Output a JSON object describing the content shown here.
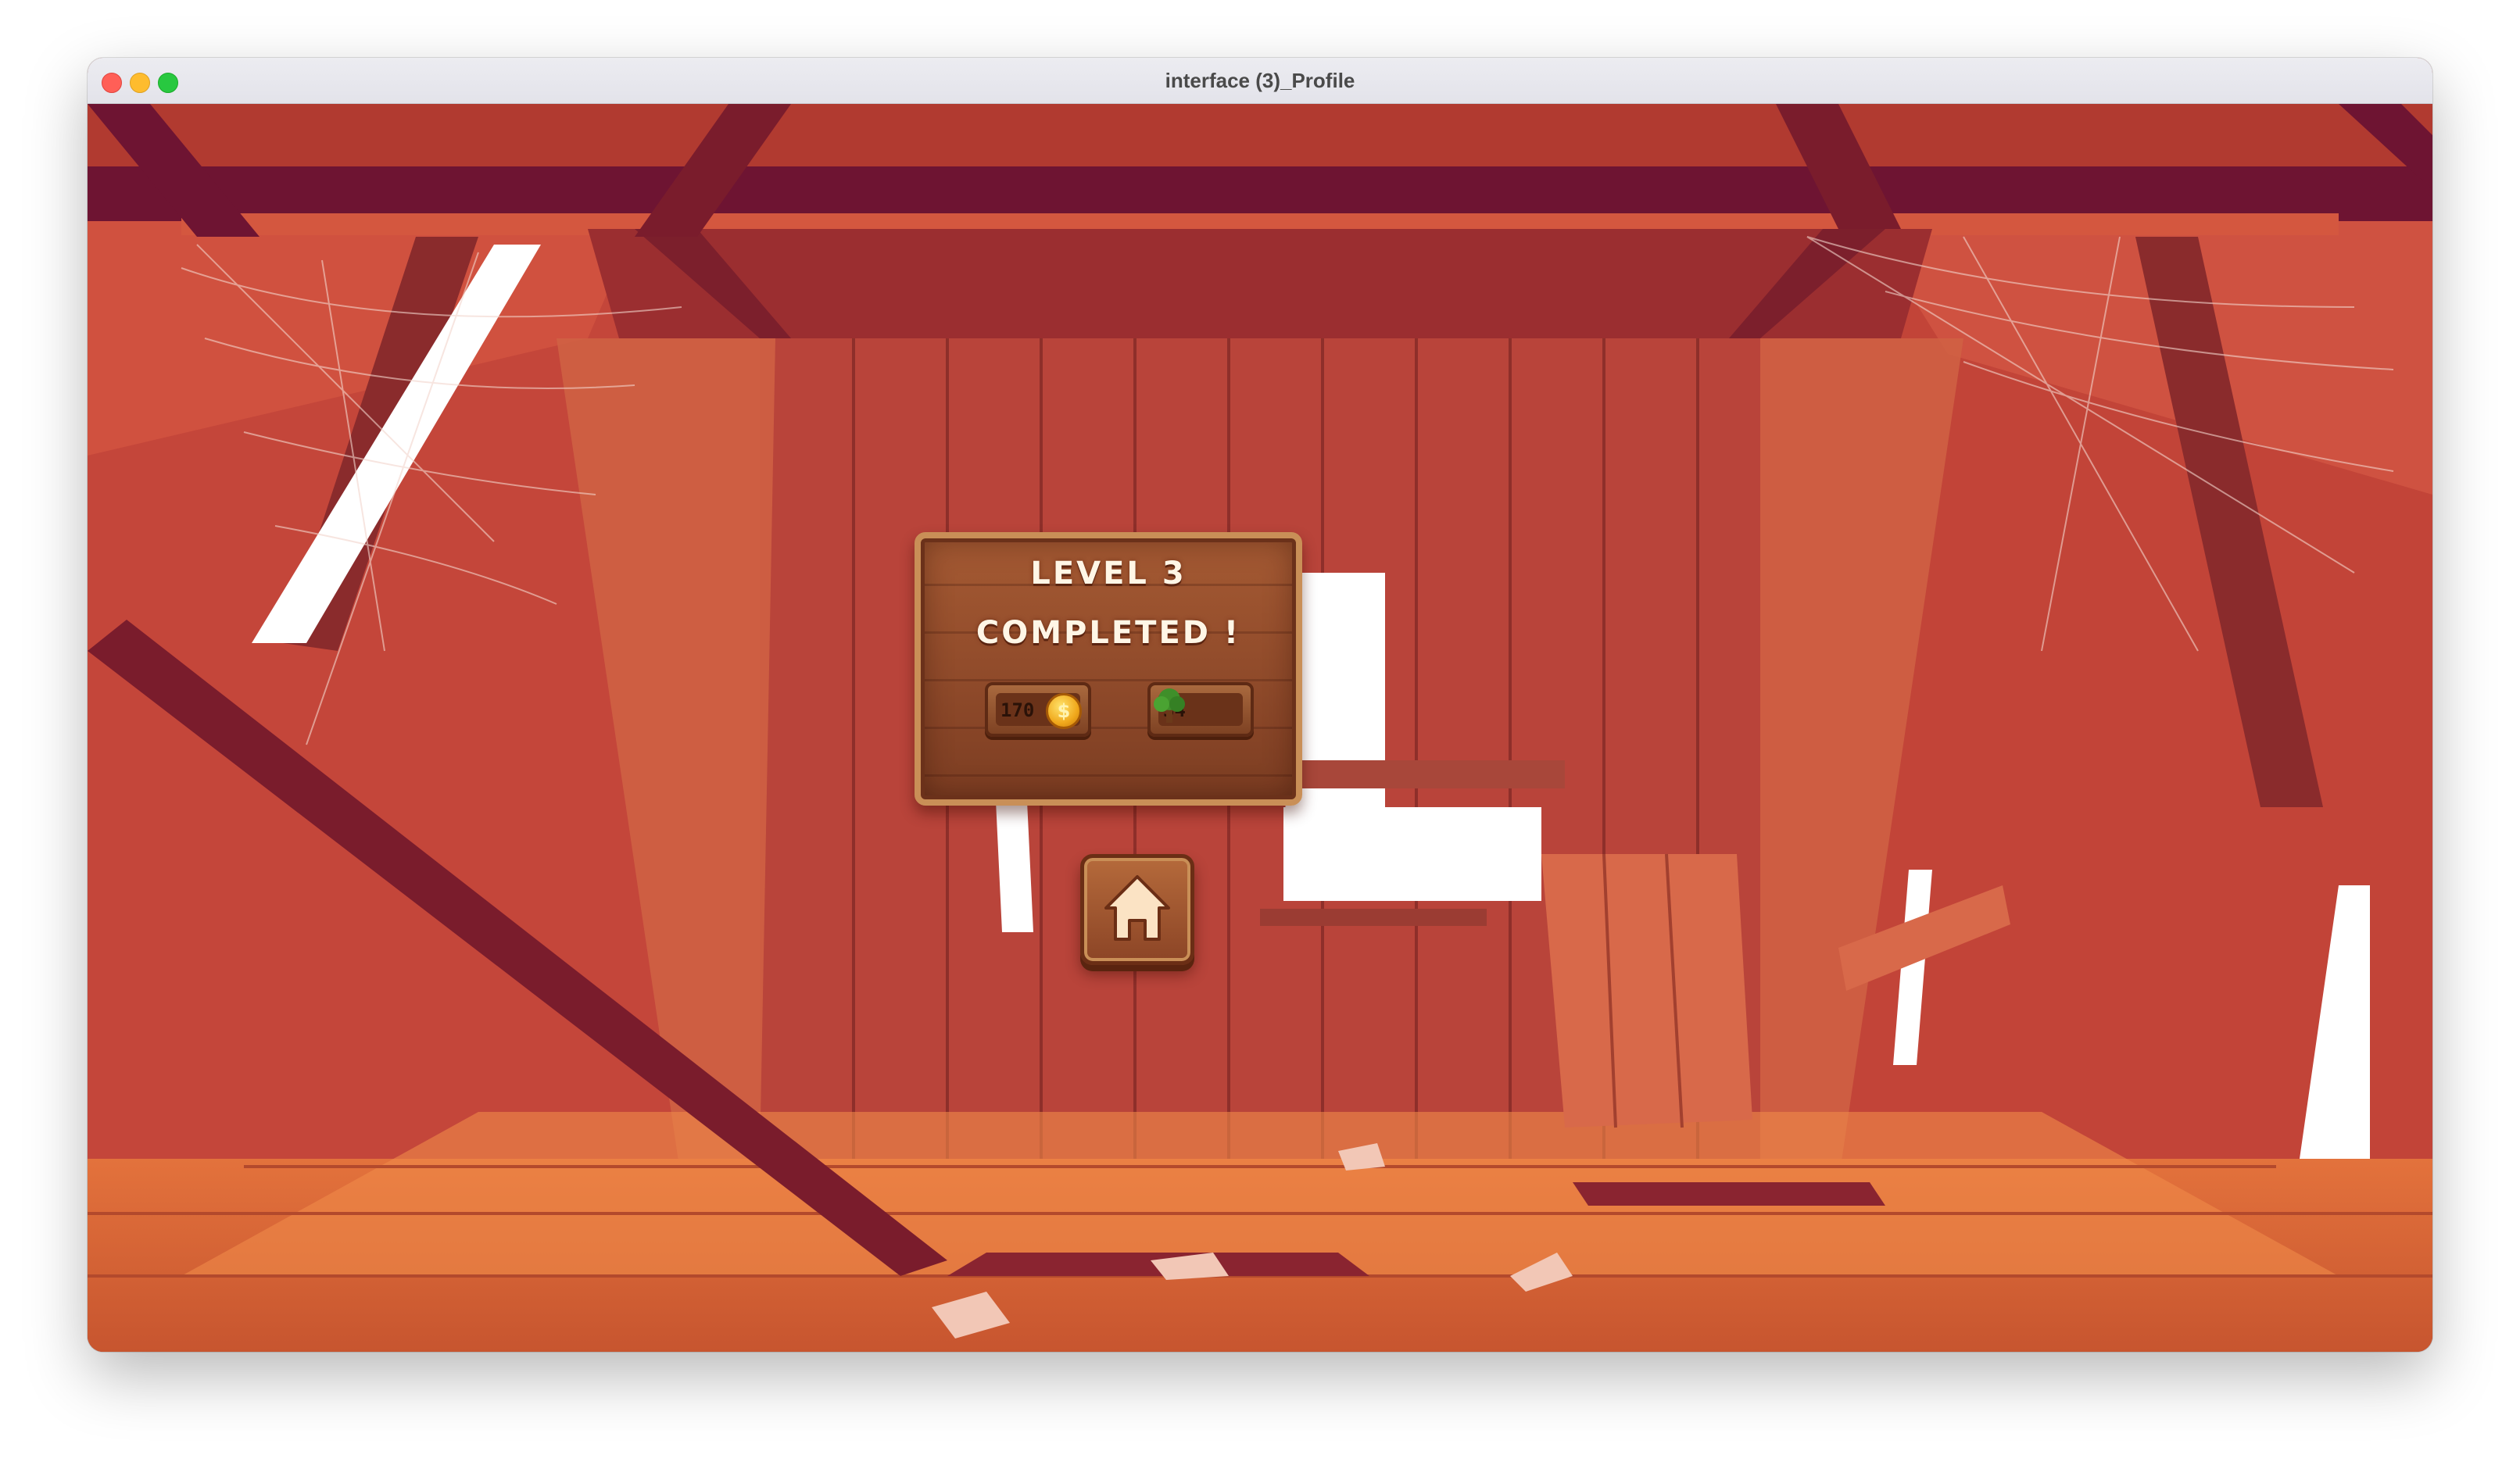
{
  "window": {
    "title": "interface (3)_Profile"
  },
  "level_complete": {
    "title_line1": "LEVEL 3",
    "title_line2": "COMPLETED !",
    "coins": {
      "value": "170",
      "icon": "coin-icon",
      "coin_symbol": "$"
    },
    "trees": {
      "value": "34",
      "icon": "tree-icon"
    }
  },
  "home_button": {
    "icon": "home-icon"
  },
  "colors": {
    "board_wood": "#8f4a2a",
    "board_border": "#c98f57",
    "title_text": "#fff6e6",
    "coin_gold": "#f0a81c",
    "tree_green": "#3f8f2a"
  }
}
